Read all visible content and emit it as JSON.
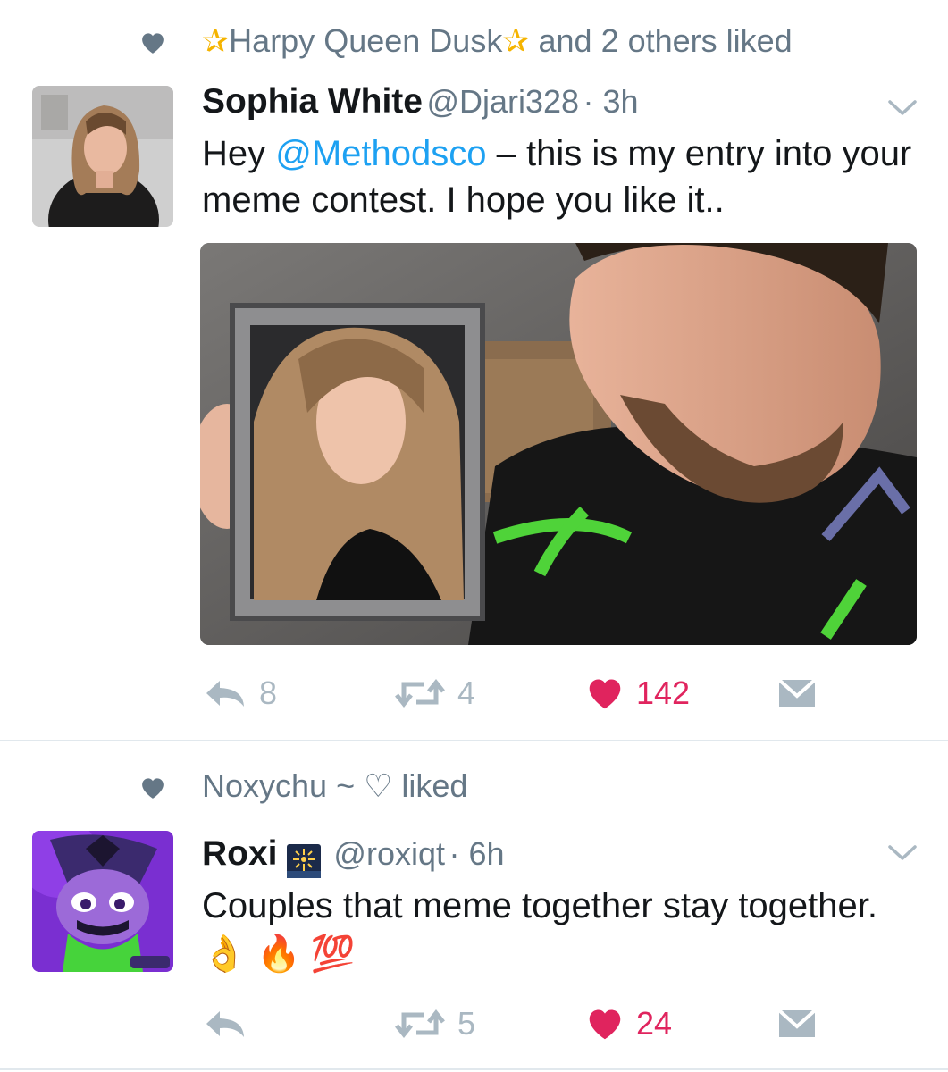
{
  "tweets": [
    {
      "context": {
        "liker_name": "Harpy Queen Dusk",
        "liker_prefix": "✰",
        "liker_suffix": "✰",
        "rest": "and 2 others liked"
      },
      "author": {
        "name": "Sophia White",
        "handle": "@Djari328",
        "time": "· 3h"
      },
      "text": {
        "before": "Hey ",
        "mention": "@Methodsco",
        "after": " – this is my entry into your meme contest. I hope you like it.."
      },
      "stats": {
        "replies": "8",
        "retweets": "4",
        "likes": "142"
      }
    },
    {
      "context": {
        "liker_name": "Noxychu ~",
        "liker_suffix": "♡",
        "rest": "liked"
      },
      "author": {
        "name": "Roxi",
        "handle": "@roxiqt",
        "time": "· 6h"
      },
      "text": {
        "main": "Couples that meme together stay together.",
        "emojis": [
          "👌",
          "🔥",
          "💯"
        ]
      },
      "stats": {
        "replies": "",
        "retweets": "5",
        "likes": "24"
      }
    }
  ],
  "icons": {
    "context": "heart-icon",
    "menu": "chevron-down-icon",
    "reply": "reply-icon",
    "retweet": "retweet-icon",
    "like": "heart-icon",
    "dm": "envelope-icon"
  },
  "colors": {
    "link": "#1da1f2",
    "like": "#e0245e",
    "muted": "#aab8c2",
    "secondary": "#657786",
    "star": "#f5b400"
  }
}
